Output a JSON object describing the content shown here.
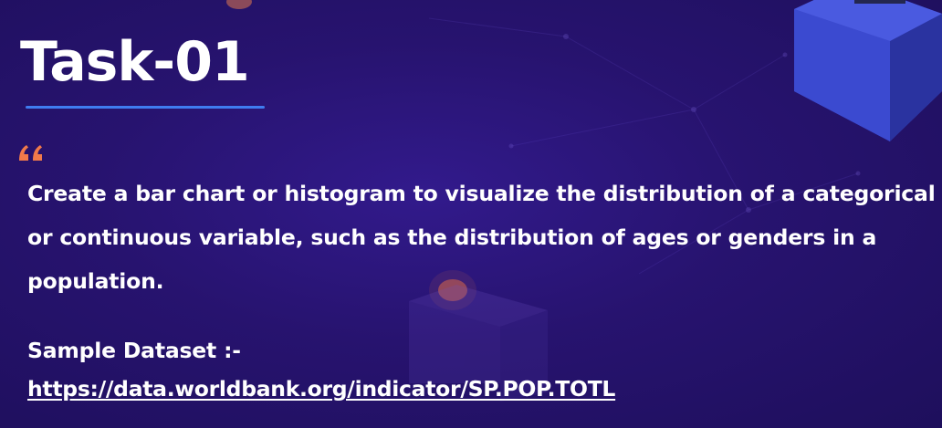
{
  "title": "Task-01",
  "quote_icon": "quote-mark-icon",
  "description": "Create a bar chart or histogram to visualize the distribution of a categorical or continuous variable, such as the distribution of ages or genders in a population.",
  "dataset": {
    "label": "Sample Dataset :-",
    "link": "https://data.worldbank.org/indicator/SP.POP.TOTL"
  },
  "colors": {
    "background": "#27136f",
    "accent_underline": "#3f7cf0",
    "quote": "#f07a4a",
    "text": "#ffffff",
    "cube": "#3a47c8"
  }
}
